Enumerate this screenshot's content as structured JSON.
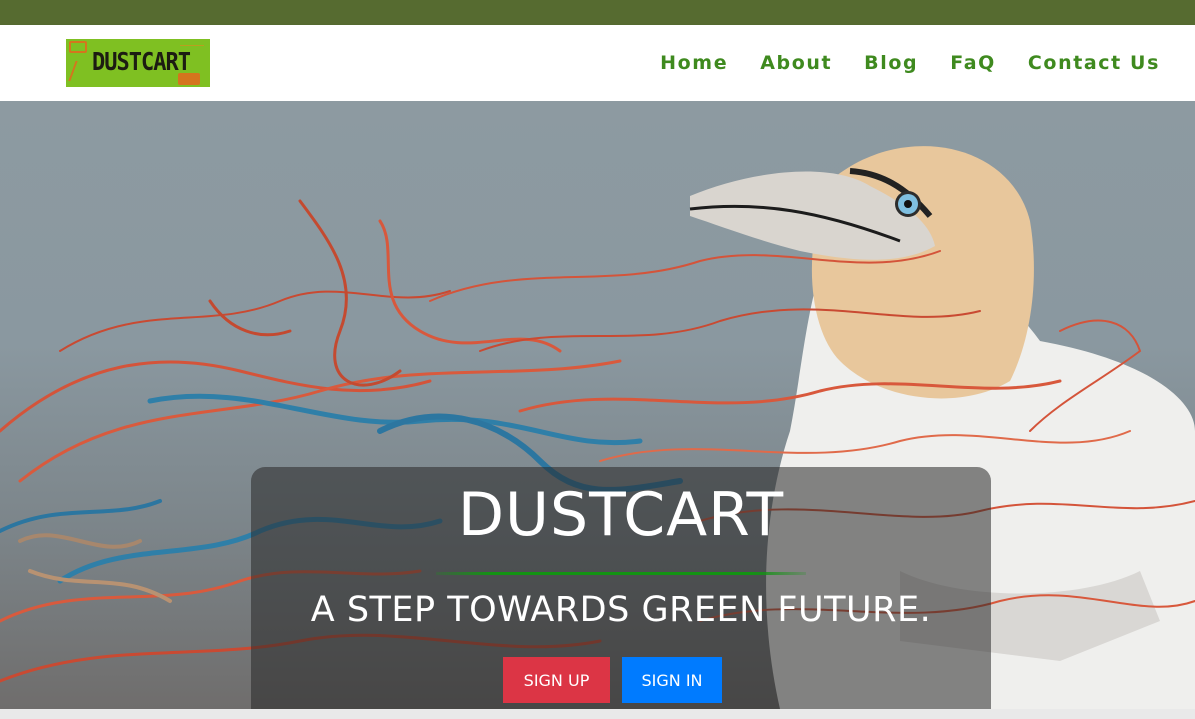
{
  "header": {
    "logo_text": "DUSTCART",
    "nav": [
      "Home",
      "About",
      "Blog",
      "FaQ",
      "Contact Us"
    ]
  },
  "hero": {
    "title": "DUSTCART",
    "tagline": "A STEP TOWARDS GREEN FUTURE.",
    "signup_label": "SIGN UP",
    "signin_label": "SIGN IN"
  },
  "colors": {
    "topbar": "#566b30",
    "nav_link": "#3f8a1f",
    "signup": "#dc3545",
    "signin": "#007bff",
    "divider": "#139313"
  },
  "icons": [
    "dustcart-logo",
    "gannet-bird-image",
    "fishing-net-image"
  ]
}
